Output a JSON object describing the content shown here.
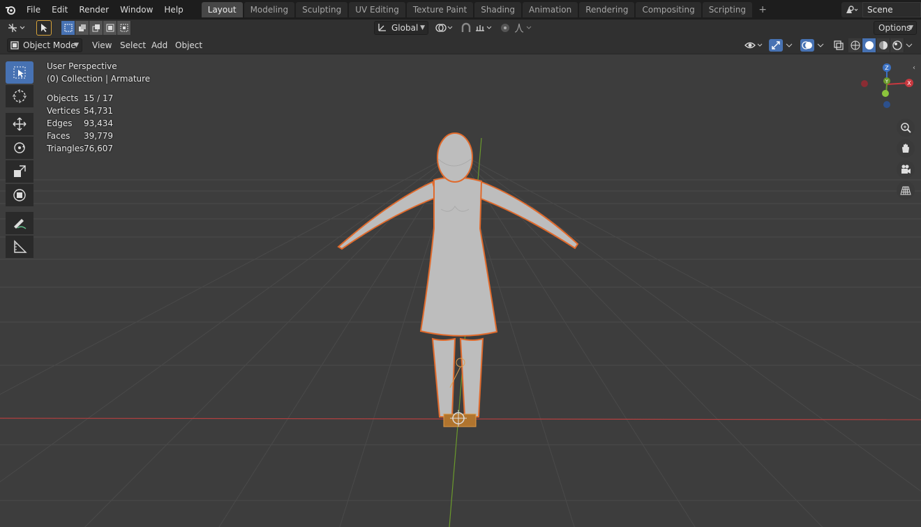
{
  "menu": {
    "file": "File",
    "edit": "Edit",
    "render": "Render",
    "window": "Window",
    "help": "Help"
  },
  "workspaces": [
    "Layout",
    "Modeling",
    "Sculpting",
    "UV Editing",
    "Texture Paint",
    "Shading",
    "Animation",
    "Rendering",
    "Compositing",
    "Scripting"
  ],
  "active_workspace": "Layout",
  "scene": {
    "name": "Scene"
  },
  "tool_header": {
    "orientation": "Global",
    "options_label": "Options"
  },
  "viewport_header": {
    "mode": "Object Mode",
    "view": "View",
    "select": "Select",
    "add": "Add",
    "object": "Object"
  },
  "overlay": {
    "perspective": "User Perspective",
    "collection": "(0) Collection | Armature",
    "stats": [
      {
        "label": "Objects",
        "value": "15 / 17"
      },
      {
        "label": "Vertices",
        "value": "54,731"
      },
      {
        "label": "Edges",
        "value": "93,434"
      },
      {
        "label": "Faces",
        "value": "39,779"
      },
      {
        "label": "Triangles",
        "value": "76,607"
      }
    ]
  },
  "gizmo": {
    "x": "X",
    "y": "Y",
    "z": "Z"
  },
  "colors": {
    "selection_outline": "#e06a2c",
    "active_tab": "#4772b3",
    "x_axis": "#c8383f",
    "y_axis": "#6b9a2c",
    "z_axis": "#3c72c4"
  }
}
